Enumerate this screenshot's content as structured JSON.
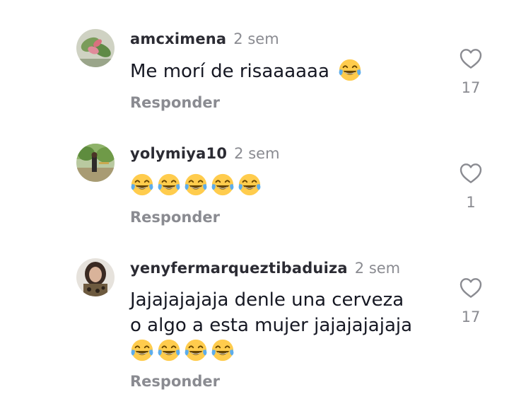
{
  "comments": [
    {
      "username": "amcximena",
      "timestamp": "2 sem",
      "text": "Me morí de risaaaaaa",
      "emojis": [
        "face-with-tears-of-joy"
      ],
      "reply_label": "Responder",
      "like_count": "17"
    },
    {
      "username": "yolymiya10",
      "timestamp": "2 sem",
      "text": "",
      "emojis": [
        "face-with-tears-of-joy",
        "face-with-tears-of-joy",
        "face-with-tears-of-joy",
        "face-with-tears-of-joy",
        "face-with-tears-of-joy"
      ],
      "reply_label": "Responder",
      "like_count": "1"
    },
    {
      "username": "yenyfermarqueztibaduiza",
      "timestamp": "2 sem",
      "text_line1": "Jajajajajaja denle una cerveza",
      "text_line2": "o algo a esta mujer jajajajajaja",
      "emojis": [
        "face-with-tears-of-joy",
        "face-with-tears-of-joy",
        "face-with-tears-of-joy",
        "face-with-tears-of-joy"
      ],
      "reply_label": "Responder",
      "like_count": "17"
    }
  ],
  "icons": {
    "like": "heart-outline-icon",
    "emoji": "face-with-tears-of-joy"
  },
  "colors": {
    "username": "#2b2b33",
    "secondary_text": "#8a8b91",
    "body_text": "#161823"
  }
}
